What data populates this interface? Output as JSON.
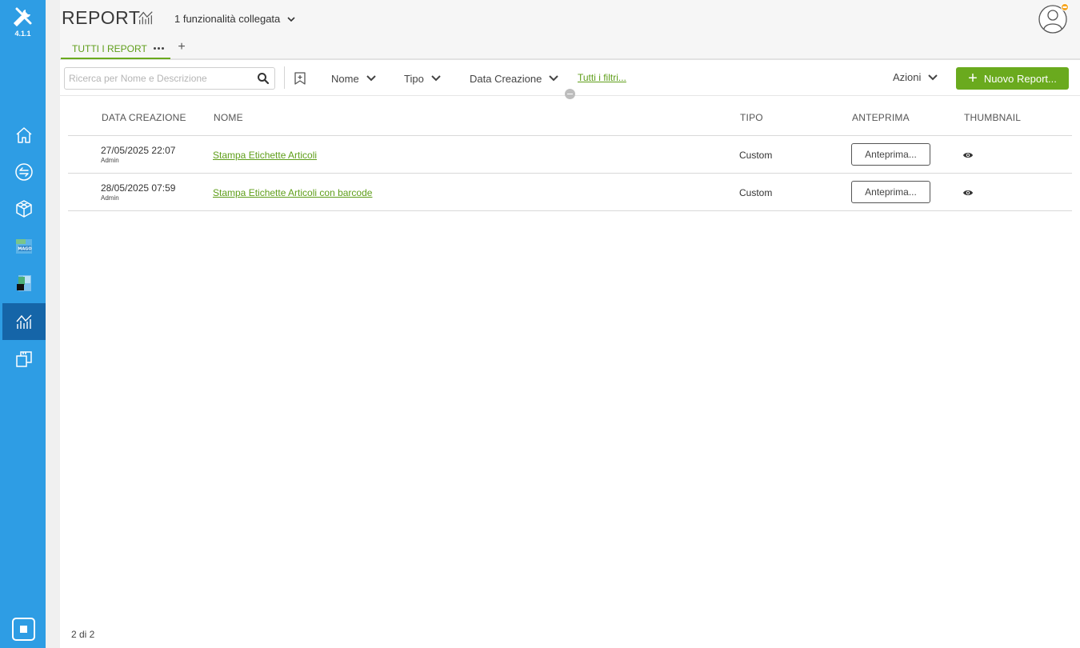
{
  "app": {
    "version": "4.1.1"
  },
  "header": {
    "title": "REPORT",
    "linked_features": "1 funzionalità collegata",
    "tabs": [
      {
        "label": "TUTTI I REPORT"
      }
    ],
    "add_tab_label": "+"
  },
  "toolbar": {
    "search_placeholder": "Ricerca per Nome e Descrizione",
    "filters": {
      "name": "Nome",
      "type": "Tipo",
      "created": "Data Creazione",
      "all": "Tutti i filtri..."
    },
    "actions_label": "Azioni",
    "new_report_label": "Nuovo Report...",
    "new_report_icon": "+"
  },
  "table": {
    "columns": {
      "created": "DATA CREAZIONE",
      "name": "NOME",
      "type": "TIPO",
      "preview": "ANTEPRIMA",
      "thumbnail": "THUMBNAIL"
    },
    "rows": [
      {
        "date": "27/05/2025 22:07",
        "user": "Admin",
        "name": "Stampa Etichette Articoli",
        "type": "Custom",
        "preview_label": "Anteprima..."
      },
      {
        "date": "28/05/2025 07:59",
        "user": "Admin",
        "name": "Stampa Etichette Articoli con barcode",
        "type": "Custom",
        "preview_label": "Anteprima..."
      }
    ]
  },
  "footer": {
    "pager": "2 di 2"
  },
  "colors": {
    "sidebar": "#2e9de4",
    "sidebar_active": "#1565a8",
    "accent_green": "#6aaa1e",
    "link_green": "#5f9e1a",
    "badge_orange": "#f5a623"
  },
  "icons": {
    "logo": "tools-icon",
    "nav": [
      "home-icon",
      "swap-icon",
      "cube-icon",
      "mago-app-icon",
      "app-tile-icon",
      "report-chart-icon",
      "copy-windows-icon"
    ],
    "thumbnail": "eye-icon"
  }
}
